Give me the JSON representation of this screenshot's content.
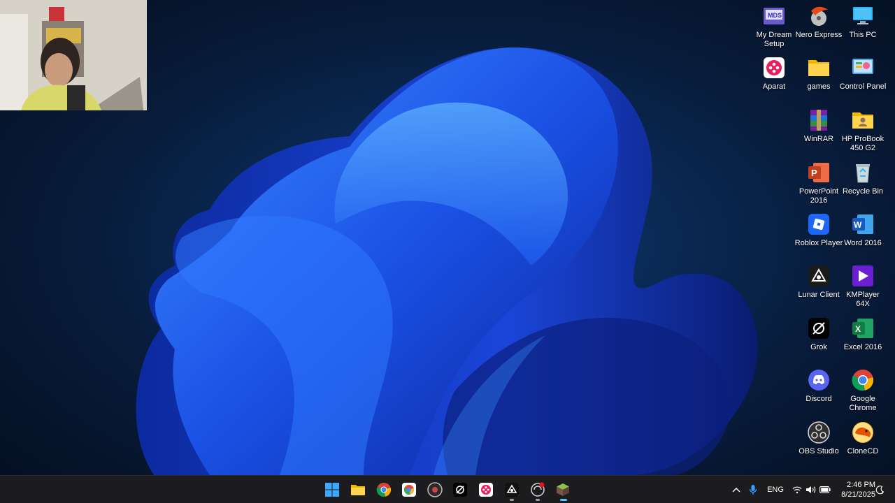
{
  "desktop": {
    "icons": [
      {
        "label": "My Dream Setup",
        "icon": "my-dream-setup-icon"
      },
      {
        "label": "Nero Express",
        "icon": "nero-express-icon"
      },
      {
        "label": "This PC",
        "icon": "this-pc-icon"
      },
      {
        "label": "Aparat",
        "icon": "aparat-icon"
      },
      {
        "label": "games",
        "icon": "folder-icon"
      },
      {
        "label": "Control Panel",
        "icon": "control-panel-icon"
      },
      {
        "label": "WinRAR",
        "icon": "winrar-icon"
      },
      {
        "label": "HP ProBook 450 G2",
        "icon": "user-folder-icon"
      },
      {
        "label": "PowerPoint 2016",
        "icon": "powerpoint-icon"
      },
      {
        "label": "Recycle Bin",
        "icon": "recycle-bin-icon"
      },
      {
        "label": "Roblox Player",
        "icon": "roblox-icon"
      },
      {
        "label": "Word 2016",
        "icon": "word-icon"
      },
      {
        "label": "Lunar Client",
        "icon": "lunar-client-icon"
      },
      {
        "label": "KMPlayer 64X",
        "icon": "kmplayer-icon"
      },
      {
        "label": "Grok",
        "icon": "grok-icon"
      },
      {
        "label": "Excel 2016",
        "icon": "excel-icon"
      },
      {
        "label": "Discord",
        "icon": "discord-icon"
      },
      {
        "label": "Google Chrome",
        "icon": "chrome-icon"
      },
      {
        "label": "OBS Studio",
        "icon": "obs-icon"
      },
      {
        "label": "CloneCD",
        "icon": "clonecd-icon"
      }
    ]
  },
  "taskbar": {
    "apps": [
      "start-icon",
      "file-explorer-icon",
      "chrome-icon",
      "chromium-icon",
      "obs-icon",
      "grok-icon",
      "aparat-icon",
      "lunar-client-icon",
      "roblox-studio-icon",
      "minecraft-icon"
    ],
    "tray": {
      "language": "ENG",
      "time": "2:46 PM",
      "date": "8/21/2025"
    }
  },
  "colors": {
    "accent": "#1e6fff",
    "taskbar_bg": "#1c1c1e"
  }
}
